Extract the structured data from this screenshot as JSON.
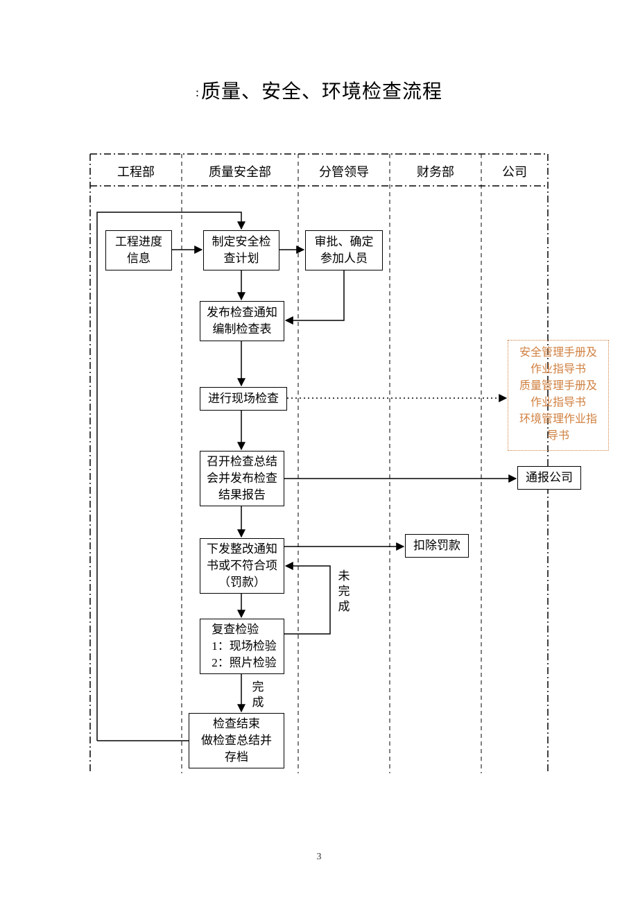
{
  "title_prefix": ":",
  "title": "质量、安全、环境检查流程",
  "lanes": {
    "l1": "工程部",
    "l2": "质量安全部",
    "l3": "分管领导",
    "l4": "财务部",
    "l5": "公司"
  },
  "nodes": {
    "progress_info": "工程进度\n信息",
    "make_plan": "制定安全检\n查计划",
    "approve": "审批、确定\n参加人员",
    "publish_notice": "发布检查通知\n编制检查表",
    "onsite_check": "进行现场检查",
    "summary_meeting": "召开检查总结\n会并发布检查\n结果报告",
    "rectify_notice": "下发整改通知\n书或不符合项\n（罚款）",
    "reinspect": "复查检验\n1：现场检验\n2：照片检验",
    "finish_archive": "检查结束\n做检查总结并\n存档",
    "deduct_fine": "扣除罚款",
    "notify_company": "通报公司"
  },
  "reference": "安全管理手册及\n作业指导书\n质量管理手册及\n作业指导书\n环境管理作业指\n导书",
  "edge_labels": {
    "incomplete": "未\n完\n成",
    "complete": "完\n成"
  },
  "page_number": "3"
}
